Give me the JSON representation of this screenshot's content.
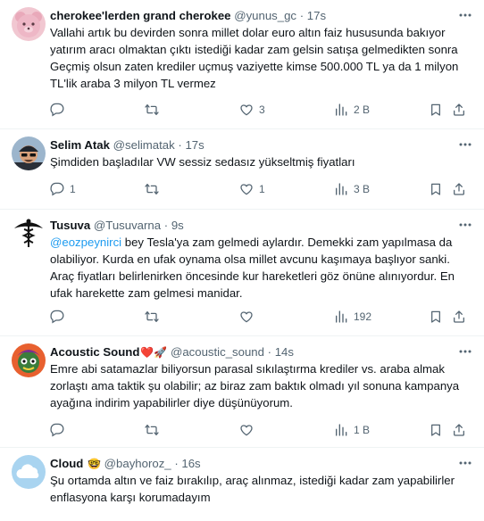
{
  "tweets": [
    {
      "name": "cherokee'lerden grand cherokee",
      "name_emoji": "",
      "handle": "@yunus_gc",
      "time": "17s",
      "mention": "",
      "text": "Vallahi artık bu devirden sonra millet dolar euro altın faiz hususunda bakıyor yatırım aracı olmaktan çıktı istediği kadar zam gelsin satışa gelmedikten sonra Geçmiş olsun zaten krediler uçmuş vaziyette kimse 500.000 TL ya da 1 milyon TL'lik araba 3 milyon TL vermez",
      "replies": "",
      "retweets": "",
      "likes": "3",
      "views": "2 B",
      "avatar_icon": "pink-teddy-bear-avatar"
    },
    {
      "name": "Selim Atak",
      "name_emoji": "",
      "handle": "@selimatak",
      "time": "17s",
      "mention": "",
      "text": "Şimdiden başladılar VW sessiz sedasız yükseltmiş fiyatları",
      "replies": "1",
      "retweets": "",
      "likes": "1",
      "views": "3 B",
      "avatar_icon": "man-with-cap-avatar"
    },
    {
      "name": "Tusuva",
      "name_emoji": "",
      "handle": "@Tusuvarna",
      "time": "9s",
      "mention": "@eozpeynirci",
      "text": " bey Tesla'ya zam gelmedi aylardır. Demekki zam yapılmasa da olabiliyor. Kurda en ufak oynama olsa millet avcunu kaşımaya başlıyor sanki. Araç fiyatları belirlenirken öncesinde kur hareketleri göz önüne alınıyordur. En ufak harekette zam gelmesi manidar.",
      "replies": "",
      "retweets": "",
      "likes": "",
      "views": "192",
      "avatar_icon": "caduceus-avatar"
    },
    {
      "name": "Acoustic Sound",
      "name_emoji": "❤️🚀",
      "handle": "@acoustic_sound",
      "time": "14s",
      "mention": "",
      "text": "Emre abi satamazlar biliyorsun parasal sıkılaştırma krediler vs. araba almak zorlaştı ama taktik şu olabilir; az biraz zam baktık olmadı yıl sonuna kampanya ayağına indirim yapabilirler diye düşünüyorum.",
      "replies": "",
      "retweets": "",
      "likes": "",
      "views": "1 B",
      "avatar_icon": "colorful-cartoon-avatar"
    },
    {
      "name": "Cloud",
      "name_emoji": "🤓",
      "handle": "@bayhoroz_",
      "time": "16s",
      "mention": "",
      "text": "Şu ortamda altın ve faiz bırakılıp, araç alınmaz, istediği kadar zam yapabilirler  enflasyona karşı korumadayım",
      "replies": "",
      "retweets": "",
      "likes": "",
      "views": "",
      "avatar_icon": "cloud-avatar"
    }
  ],
  "ui": {
    "dot": "·"
  },
  "colors": {
    "text": "#0f1419",
    "secondary": "#536471",
    "link": "#1d9bf0",
    "border": "#eff3f4"
  }
}
